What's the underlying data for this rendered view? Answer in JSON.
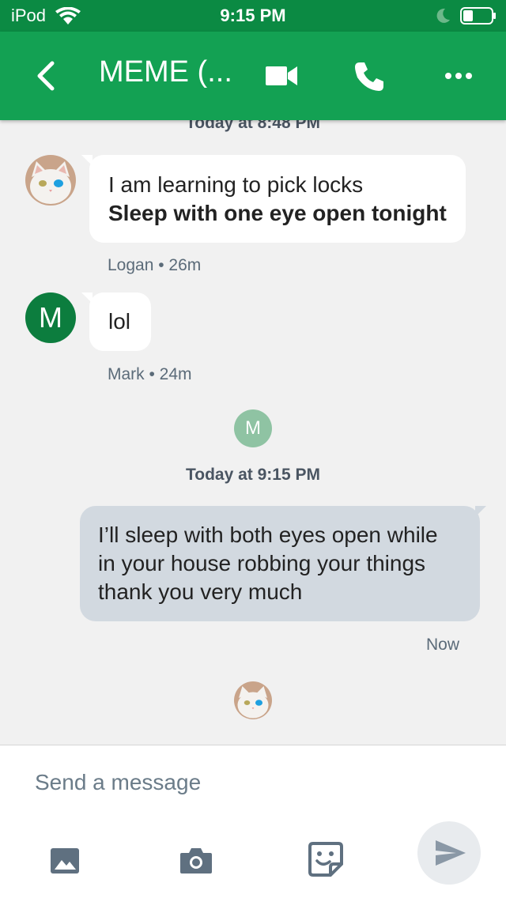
{
  "status_bar": {
    "carrier": "iPod",
    "time": "9:15 PM",
    "wifi_icon": "wifi-icon",
    "moon_icon": "moon-icon",
    "battery_icon": "battery-icon"
  },
  "header": {
    "title": "MEME (...",
    "back_icon": "chevron-left-icon",
    "video_icon": "video-camera-icon",
    "call_icon": "phone-icon",
    "more_icon": "more-horizontal-icon",
    "colors": {
      "status_bar": "#0b8a43",
      "header": "#13a153"
    }
  },
  "conversation": {
    "top_timestamp": "Today at 8:48 PM",
    "messages": [
      {
        "sender": "Logan",
        "avatar": "cat-avatar",
        "line1": "I am learning to pick locks",
        "line2": "Sleep with one eye open tonight",
        "meta": "Logan • 26m"
      },
      {
        "sender": "Mark",
        "avatar_initial": "M",
        "text": "lol",
        "meta": "Mark • 24m"
      }
    ],
    "read_receipt_initial": "M",
    "mid_timestamp": "Today at 9:15 PM",
    "outgoing": {
      "line1": "I’ll sleep with both eyes open while",
      "line2": "in your house robbing your things",
      "line3": "thank you very much",
      "meta": "Now"
    },
    "read_receipt_avatar": "cat-avatar",
    "colors": {
      "incoming_bubble": "#ffffff",
      "outgoing_bubble": "#d2d9e0",
      "avatar_dark_green": "#0c7d3e",
      "avatar_light_green": "#8fc3a3"
    }
  },
  "composer": {
    "placeholder": "Send a message",
    "tools": [
      "image-icon",
      "camera-icon",
      "sticker-icon"
    ],
    "send_icon": "send-icon"
  }
}
